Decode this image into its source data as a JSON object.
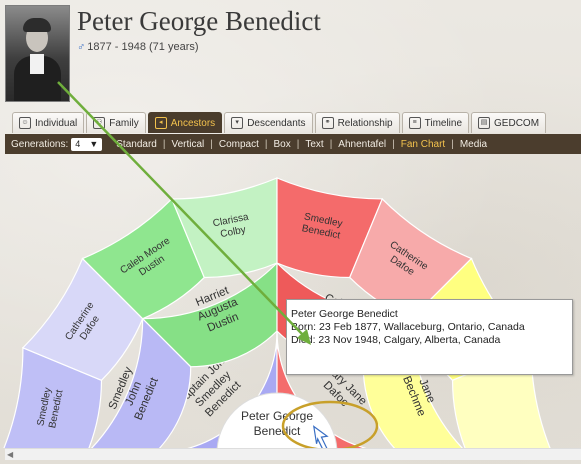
{
  "person": {
    "name": "Peter George Benedict",
    "sex_symbol": "♂",
    "lifespan": "1877 - 1948 (71 years)"
  },
  "tabs": [
    {
      "label": "Individual",
      "icon": "person-icon"
    },
    {
      "label": "Family",
      "icon": "family-icon"
    },
    {
      "label": "Ancestors",
      "icon": "ancestors-icon",
      "active": true
    },
    {
      "label": "Descendants",
      "icon": "descendants-icon"
    },
    {
      "label": "Relationship",
      "icon": "relationship-icon"
    },
    {
      "label": "Timeline",
      "icon": "timeline-icon"
    },
    {
      "label": "GEDCOM",
      "icon": "gedcom-icon"
    }
  ],
  "toolbar": {
    "generations_label": "Generations:",
    "generations_value": "4",
    "items": [
      "Standard",
      "Vertical",
      "Compact",
      "Box",
      "Text",
      "Ahnentafel",
      "Fan Chart",
      "Media"
    ],
    "active_item": "Fan Chart"
  },
  "fan": {
    "center": {
      "line1": "Peter George",
      "line2": "Benedict"
    },
    "gen1": [
      {
        "lines": [
          "Captain John",
          "Smedley",
          "Benedict"
        ],
        "color": "#a9a9f3"
      },
      {
        "lines": [
          "Mary Jane",
          "Dafoe"
        ],
        "color": "#f46c6c"
      }
    ],
    "gen2": [
      {
        "lines": [
          "Smedley",
          "John",
          "Benedict"
        ],
        "color": "#b9b9f5"
      },
      {
        "lines": [
          "Harriet",
          "Augusta",
          "Dustin"
        ],
        "color": "#86e086"
      },
      {
        "lines": [
          "Caleb",
          "Benedict"
        ],
        "color": "#ee5a5a"
      },
      {
        "lines": [
          "Jane",
          "Bechme"
        ],
        "color": "#ffff99"
      }
    ],
    "gen3": [
      {
        "lines": [
          "Smedley",
          "Benedict"
        ],
        "color": "#bfbff6"
      },
      {
        "lines": [
          "Catherine",
          "Dafoe"
        ],
        "color": "#d8d8f8"
      },
      {
        "lines": [
          "Caleb Moore",
          "Dustin"
        ],
        "color": "#8fe68f"
      },
      {
        "lines": [
          "Clarissa",
          "Colby"
        ],
        "color": "#c3f2c3"
      },
      {
        "lines": [
          "Smedley",
          "Benedict"
        ],
        "color": "#f46b6b"
      },
      {
        "lines": [
          "Catherine",
          "Dafoe"
        ],
        "color": "#f7aaaa"
      },
      {
        "lines": [
          ""
        ],
        "color": "#ffff80"
      },
      {
        "lines": [
          ""
        ],
        "color": "#ffffc0"
      }
    ]
  },
  "tooltip": {
    "name": "Peter George Benedict",
    "born": "Born: 23 Feb 1877, Wallaceburg, Ontario, Canada",
    "died": "Died: 23 Nov 1948, Calgary, Alberta, Canada"
  },
  "colors": {
    "toolbar_bg": "#4b3d2d",
    "active_accent": "#f3c24d",
    "annotation_arrow": "#6fae3c",
    "annotation_circle": "#c8a02a"
  }
}
